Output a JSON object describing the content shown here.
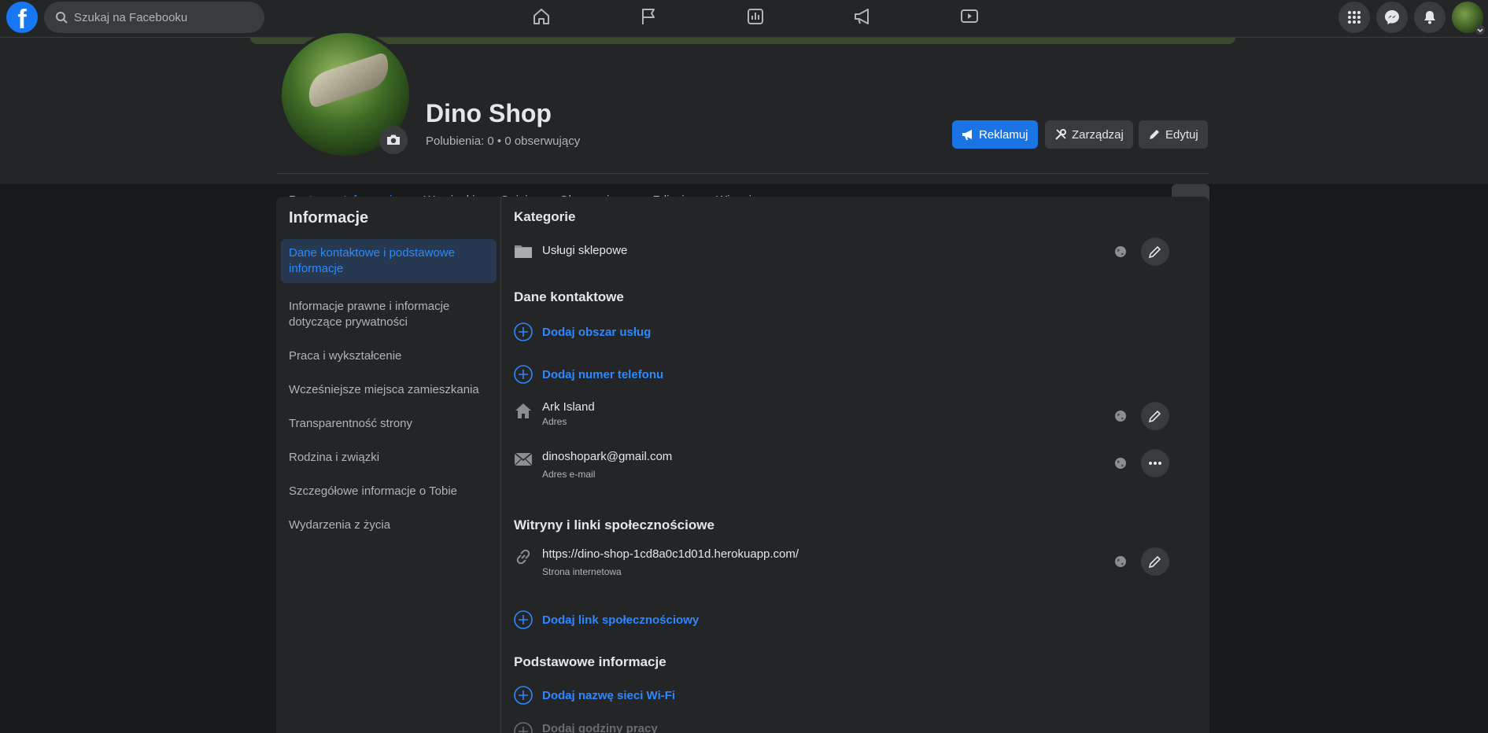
{
  "topbar": {
    "search_placeholder": "Szukaj na Facebooku",
    "logo_letter": "f"
  },
  "page": {
    "title": "Dino Shop",
    "stats": "Polubienia: 0 • 0 obserwujący"
  },
  "header_buttons": {
    "advertise": "Reklamuj",
    "manage": "Zarządzaj",
    "edit": "Edytuj"
  },
  "tabs": [
    "Posty",
    "Informacje",
    "Wzmianki",
    "Opinie",
    "Obserwujący",
    "Zdjęcia",
    "Więcej"
  ],
  "left_nav": {
    "title": "Informacje",
    "items": [
      "Dane kontaktowe i podstawowe informacje",
      "Informacje prawne i informacje dotyczące prywatności",
      "Praca i wykształcenie",
      "Wcześniejsze miejsca zamieszkania",
      "Transparentność strony",
      "Rodzina i związki",
      "Szczegółowe informacje o Tobie",
      "Wydarzenia z życia"
    ]
  },
  "sections": {
    "categories": {
      "title": "Kategorie",
      "value": "Usługi sklepowe"
    },
    "contact": {
      "title": "Dane kontaktowe",
      "add_service_area": "Dodaj obszar usług",
      "add_phone": "Dodaj numer telefonu",
      "address": "Ark Island",
      "address_label": "Adres",
      "email": "dinoshopark@gmail.com",
      "email_label": "Adres e-mail"
    },
    "websites": {
      "title": "Witryny i linki społecznościowe",
      "url": "https://dino-shop-1cd8a0c1d01d.herokuapp.com/",
      "url_label": "Strona internetowa",
      "add_social": "Dodaj link społecznościowy"
    },
    "basic": {
      "title": "Podstawowe informacje",
      "add_wifi": "Dodaj nazwę sieci Wi-Fi",
      "add_hours": "Dodaj godziny pracy"
    }
  },
  "colors": {
    "background": "#18191a",
    "surface": "#242526",
    "accent": "#2d88ff",
    "primary_button": "#1b74e4"
  }
}
